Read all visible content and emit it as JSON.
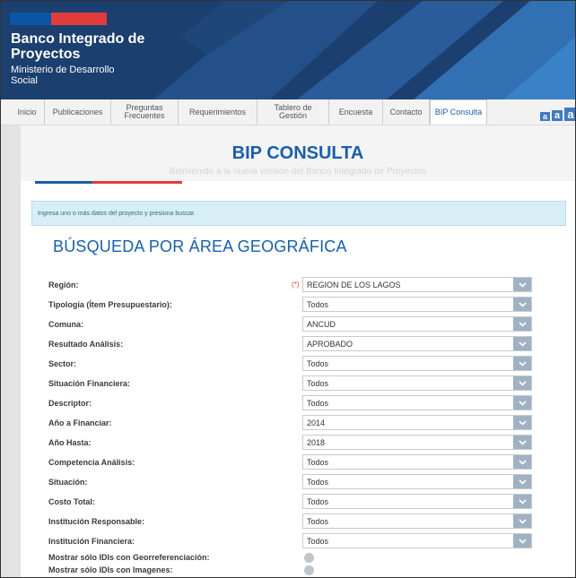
{
  "header": {
    "title": "Banco Integrado de Proyectos",
    "subtitle": "Ministerio de Desarrollo Social"
  },
  "nav": {
    "items": [
      {
        "label": "Inicio"
      },
      {
        "label": "Publicaciones"
      },
      {
        "label": "Preguntas Frecuentes"
      },
      {
        "label": "Requerimientos"
      },
      {
        "label": "Tablero de Gestión"
      },
      {
        "label": "Encuesta"
      },
      {
        "label": "Contacto"
      },
      {
        "label": "BIP Consulta"
      }
    ],
    "font_buttons": [
      "a",
      "a",
      "a"
    ]
  },
  "main": {
    "title": "BIP CONSULTA",
    "subtitle": "Bienvenido a la nueva versión del Banco Integrado de Proyectos",
    "info": "Ingresa uno o más datos del proyecto y presiona buscar.",
    "section_title": "BÚSQUEDA POR ÁREA GEOGRÁFICA",
    "required_mark": "(*)"
  },
  "form": {
    "fields": [
      {
        "label": "Región:",
        "value": "REGION DE LOS LAGOS"
      },
      {
        "label": "Tipología (Ítem Presupuestario):",
        "value": "Todos"
      },
      {
        "label": "Comuna:",
        "value": "ANCUD"
      },
      {
        "label": "Resultado Análisis:",
        "value": "APROBADO"
      },
      {
        "label": "Sector:",
        "value": "Todos"
      },
      {
        "label": "Situación Financiera:",
        "value": "Todos"
      },
      {
        "label": "Descriptor:",
        "value": "Todos"
      },
      {
        "label": "Año a Financiar:",
        "value": "2014"
      },
      {
        "label": "Año Hasta:",
        "value": "2018"
      },
      {
        "label": "Competencia Análisis:",
        "value": "Todos"
      },
      {
        "label": "Situación:",
        "value": "Todos"
      },
      {
        "label": "Costo Total:",
        "value": "Todos"
      },
      {
        "label": "Institución Responsable:",
        "value": "Todos"
      },
      {
        "label": "Institución Financiera:",
        "value": "Todos"
      }
    ],
    "toggles": [
      {
        "label": "Mostrar sólo IDIs con Georreferenciación:"
      },
      {
        "label": "Mostrar sólo IDIs con Imagenes:"
      }
    ]
  },
  "colors": {
    "header_bg": "#1b3f6e",
    "accent_blue": "#1a5fa8",
    "accent_red": "#e23b3b"
  }
}
